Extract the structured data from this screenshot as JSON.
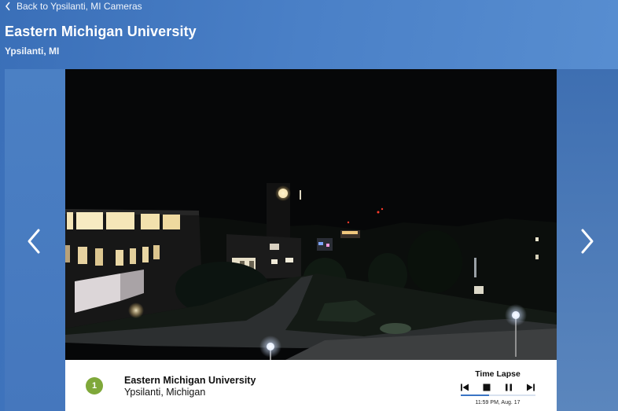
{
  "header": {
    "back_label": "Back to Ypsilanti, MI Cameras",
    "title": "Eastern Michigan University",
    "subtitle": "Ypsilanti, MI"
  },
  "camera": {
    "number": "1",
    "name": "Eastern Michigan University",
    "location": "Ypsilanti, Michigan"
  },
  "timelapse": {
    "label": "Time Lapse",
    "timestamp": "11:59 PM, Aug. 17",
    "progress": 0.38,
    "controls": [
      "skip-back-icon",
      "stop-icon",
      "pause-icon",
      "skip-forward-icon"
    ]
  },
  "colors": {
    "accent": "#3a74c4",
    "badge": "#7fa83a",
    "background": "#4a80c7"
  },
  "icons": {
    "back": "chevron-left-icon",
    "prev": "chevron-left-icon",
    "next": "chevron-right-icon"
  }
}
